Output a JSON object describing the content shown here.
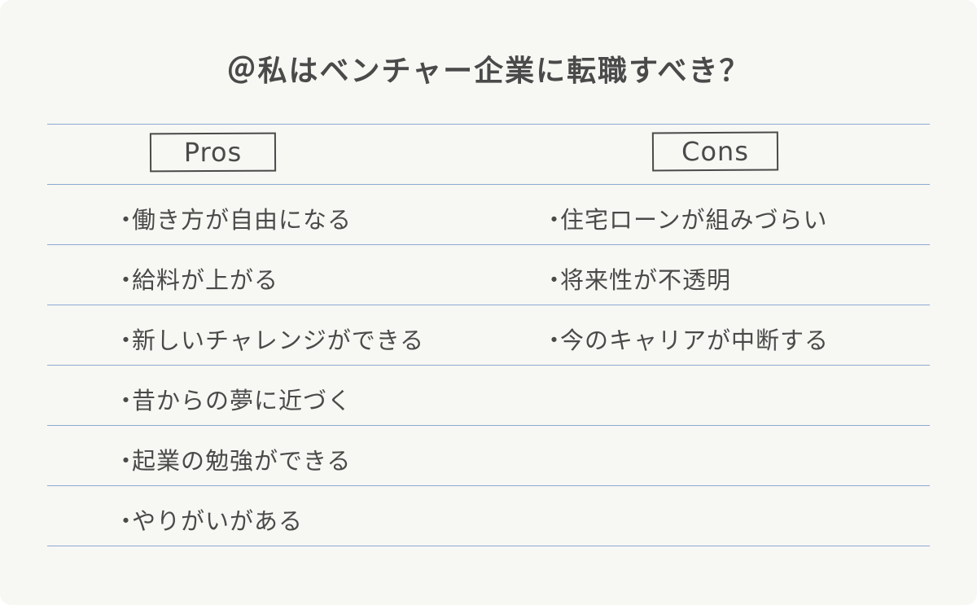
{
  "title": "＠私はベンチャー企業に転職すべき？",
  "columns": {
    "pros": {
      "header": "Pros",
      "items": [
        "働き方が自由になる",
        "給料が上がる",
        "新しいチャレンジができる",
        "昔からの夢に近づく",
        "起業の勉強ができる",
        "やりがいがある"
      ]
    },
    "cons": {
      "header": "Cons",
      "items": [
        "住宅ローンが組みづらい",
        "将来性が不透明",
        "今のキャリアが中断する"
      ]
    }
  },
  "bullet": "・",
  "colors": {
    "background": "#f7f7f3",
    "text": "#4a4a4a",
    "rule": "#8eaad3"
  }
}
